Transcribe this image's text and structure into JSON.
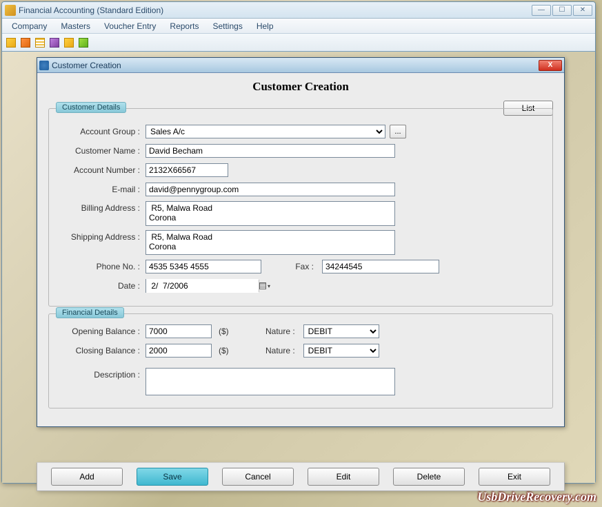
{
  "app": {
    "title": "Financial Accounting (Standard Edition)"
  },
  "menubar": {
    "items": [
      "Company",
      "Masters",
      "Voucher Entry",
      "Reports",
      "Settings",
      "Help"
    ]
  },
  "dialog": {
    "title": "Customer Creation",
    "heading": "Customer Creation",
    "list_btn": "List",
    "close_label": "X"
  },
  "customer": {
    "legend": "Customer Details",
    "labels": {
      "account_group": "Account Group :",
      "customer_name": "Customer Name :",
      "account_number": "Account Number :",
      "email": "E-mail :",
      "billing": "Billing Address :",
      "shipping": "Shipping Address :",
      "phone": "Phone No. :",
      "fax": "Fax :",
      "date": "Date :"
    },
    "values": {
      "account_group": "Sales A/c",
      "customer_name": "David Becham",
      "account_number": "2132X66567",
      "email": "david@pennygroup.com",
      "billing": " R5, Malwa Road\nCorona",
      "shipping": " R5, Malwa Road\nCorona",
      "phone": "4535 5345 4555",
      "fax": "34244545",
      "date": " 2/  7/2006"
    },
    "ellipsis": "..."
  },
  "financial": {
    "legend": "Financial Details",
    "labels": {
      "opening": "Opening Balance :",
      "closing": "Closing Balance :",
      "nature": "Nature :",
      "description": "Description :",
      "currency": "($)"
    },
    "values": {
      "opening": "7000",
      "closing": "2000",
      "nature_open": "DEBIT",
      "nature_close": "DEBIT",
      "description": ""
    }
  },
  "buttons": {
    "add": "Add",
    "save": "Save",
    "cancel": "Cancel",
    "edit": "Edit",
    "delete": "Delete",
    "exit": "Exit"
  },
  "watermark": "UsbDriveRecovery.com"
}
